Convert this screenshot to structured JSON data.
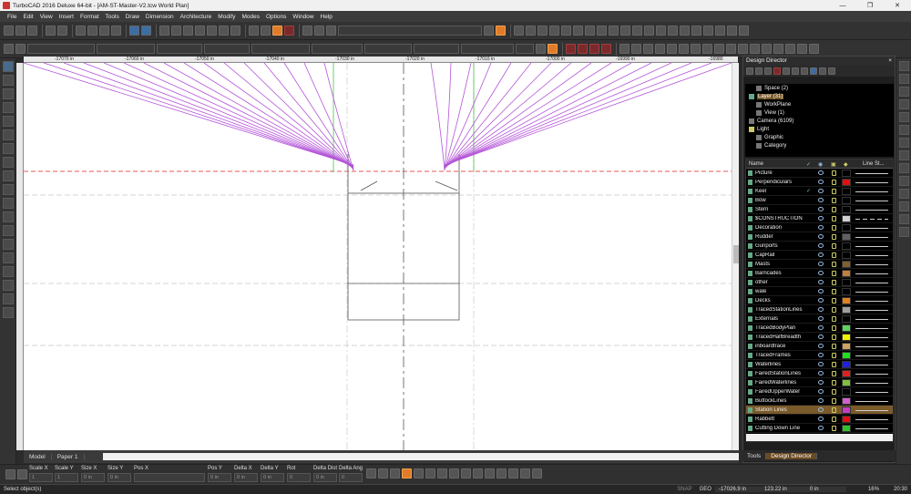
{
  "window": {
    "title": "TurboCAD 2016 Deluxe 64-bit - [AM-ST-Master-V2.tcw World Plan]",
    "min": "—",
    "max": "❐",
    "close": "✕"
  },
  "menu": [
    "File",
    "Edit",
    "View",
    "Insert",
    "Format",
    "Tools",
    "Draw",
    "Dimension",
    "Architecture",
    "Modify",
    "Modes",
    "Options",
    "Window",
    "Help"
  ],
  "ruler": {
    "ticks": [
      "-17070 in",
      "-17060 in",
      "-17050 in",
      "-17040 in",
      "-17030 in",
      "-17020 in",
      "-17010 in",
      "-17000 in",
      "-16990 in",
      "-16980"
    ]
  },
  "sheet_tabs": {
    "model": "Model",
    "paper": "Paper 1"
  },
  "coords": {
    "labels": [
      "Scale X",
      "Scale Y",
      "Size X",
      "Size Y",
      "Pos X",
      "Pos Y",
      "Delta X",
      "Delta Y",
      "Rot",
      "Delta Dist",
      "Delta Ang"
    ],
    "values": [
      "1",
      "1",
      "0 in",
      "0 in",
      "",
      "0 in",
      "0 in",
      "0 in",
      "0",
      "0 in",
      "0"
    ]
  },
  "status": {
    "message": "Select object(s)",
    "snap": "SNAP",
    "geo": "GEO",
    "x": "-17026.9 in",
    "y": "123.22 in",
    "z": "0 in",
    "zoom": "16%",
    "time": "20:30"
  },
  "design_director": {
    "title": "Design Director",
    "close": "×",
    "tree": [
      {
        "label": "Space (2)"
      },
      {
        "label": "Layer (31)",
        "selected": true
      },
      {
        "label": "WorkPlane"
      },
      {
        "label": "View (1)"
      },
      {
        "label": "Camera (6109)"
      },
      {
        "label": "Light"
      },
      {
        "label": "Graphic"
      },
      {
        "label": "Category"
      }
    ],
    "columns": {
      "name": "Name",
      "line_style": "Line St..."
    },
    "layers": [
      {
        "name": "Picture",
        "color": "#000000"
      },
      {
        "name": "Perpendiculars",
        "color": "#e01010"
      },
      {
        "name": "Keel",
        "color": "#000000",
        "active": true
      },
      {
        "name": "Bow",
        "color": "#000000"
      },
      {
        "name": "Stern",
        "color": "#000000"
      },
      {
        "name": "$CONSTRUCTION",
        "color": "#d0d0d0",
        "dashed": true
      },
      {
        "name": "Decoration",
        "color": "#000000"
      },
      {
        "name": "Rudder",
        "color": "#606060"
      },
      {
        "name": "Gunports",
        "color": "#000000"
      },
      {
        "name": "CapRail",
        "color": "#000000"
      },
      {
        "name": "Masts",
        "color": "#806030"
      },
      {
        "name": "Barricades",
        "color": "#c08040"
      },
      {
        "name": "other",
        "color": "#000000"
      },
      {
        "name": "wale",
        "color": "#000000"
      },
      {
        "name": "Decks",
        "color": "#e08020"
      },
      {
        "name": "TracedStationLines",
        "color": "#a0a0a0"
      },
      {
        "name": "Externals",
        "color": "#000000"
      },
      {
        "name": "TracedBodyPlan",
        "color": "#60d060"
      },
      {
        "name": "TracedHalfBreadth",
        "color": "#f0f000"
      },
      {
        "name": "inboardtrace",
        "color": "#d0a060"
      },
      {
        "name": "TracedFrames",
        "color": "#20e020"
      },
      {
        "name": "Waterlines",
        "color": "#2020e0"
      },
      {
        "name": "FairedStationLines",
        "color": "#e02020"
      },
      {
        "name": "FairedWaterlines",
        "color": "#80c040"
      },
      {
        "name": "FairedUpperWater",
        "color": "#000000"
      },
      {
        "name": "ButtockLines",
        "color": "#d060d0"
      },
      {
        "name": "Station Lines",
        "color": "#c040c0",
        "selected": true
      },
      {
        "name": "Rabbett",
        "color": "#e01010"
      },
      {
        "name": "Cutting Down Line",
        "color": "#30c030"
      }
    ],
    "tabs": [
      "Tools",
      "Design Director"
    ]
  }
}
